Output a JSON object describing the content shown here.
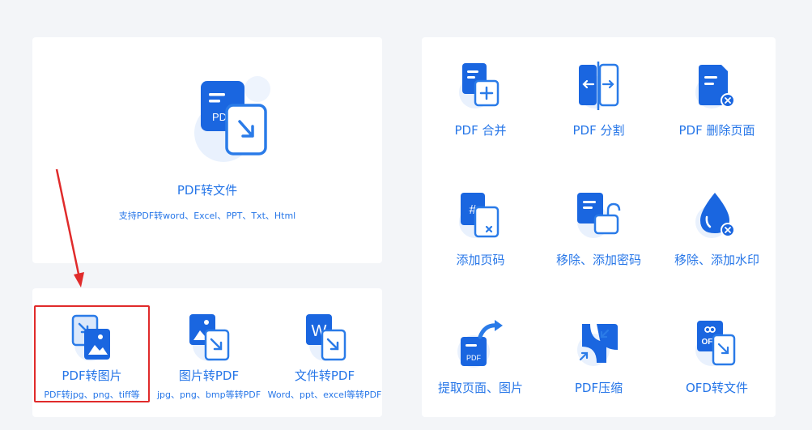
{
  "hero": {
    "title": "PDF转文件",
    "subtitle": "支持PDF转word、Excel、PPT、Txt、Html",
    "icon": "pdf-convert-icon",
    "icon_text": "PDF"
  },
  "bottom_tools": [
    {
      "label": "PDF转图片",
      "desc": "PDF转jpg、png、tiff等",
      "icon": "pdf-to-image-icon"
    },
    {
      "label": "图片转PDF",
      "desc": "jpg、png、bmp等转PDF",
      "icon": "image-to-pdf-icon"
    },
    {
      "label": "文件转PDF",
      "desc": "Word、ppt、excel等转PDF",
      "icon": "file-to-pdf-icon",
      "icon_text": "W"
    }
  ],
  "tools": [
    {
      "label": "PDF 合并",
      "icon": "merge-icon"
    },
    {
      "label": "PDF 分割",
      "icon": "split-icon"
    },
    {
      "label": "PDF 删除页面",
      "icon": "delete-page-icon"
    },
    {
      "label": "添加页码",
      "icon": "page-number-icon",
      "icon_text": "#"
    },
    {
      "label": "移除、添加密码",
      "icon": "password-lock-icon"
    },
    {
      "label": "移除、添加水印",
      "icon": "watermark-icon"
    },
    {
      "label": "提取页面、图片",
      "icon": "extract-icon",
      "icon_text": "PDF"
    },
    {
      "label": "PDF压缩",
      "icon": "compress-icon"
    },
    {
      "label": "OFD转文件",
      "icon": "ofd-convert-icon",
      "icon_text": "OFD"
    }
  ],
  "colors": {
    "primary": "#2676e8",
    "dark": "#1a5fd0",
    "light": "#e6f0fd",
    "highlight": "#e02b2b"
  }
}
